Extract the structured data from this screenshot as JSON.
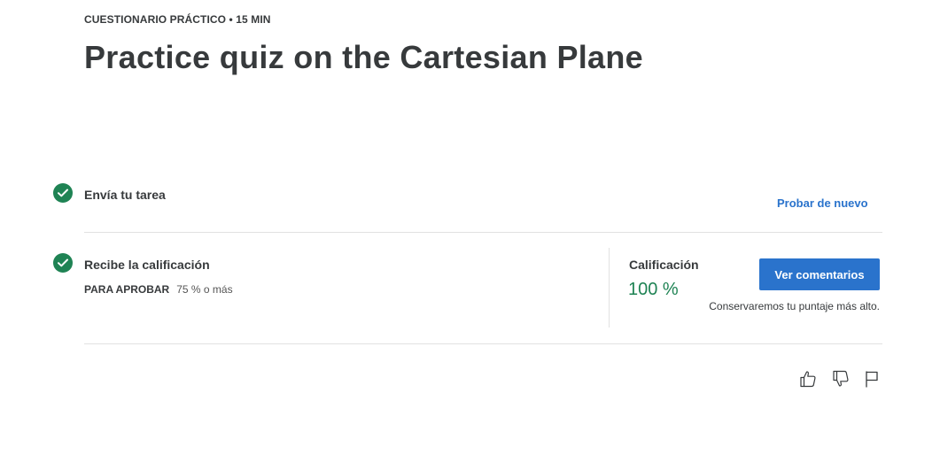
{
  "header": {
    "eyebrow": "CUESTIONARIO PRÁCTICO • 15 MIN",
    "title": "Practice quiz on the Cartesian Plane"
  },
  "steps": [
    {
      "label": "Envía tu tarea",
      "status": "complete",
      "action_label": "Probar de nuevo"
    },
    {
      "label": "Recibe la calificación",
      "status": "complete",
      "pass_key": "PARA APROBAR",
      "pass_value": "75 % o más"
    }
  ],
  "grade": {
    "label": "Calificación",
    "value": "100 %",
    "button_label": "Ver comentarios",
    "note": "Conservaremos tu puntaje más alto."
  },
  "feedback_icons": [
    "thumbs-up-icon",
    "thumbs-down-icon",
    "flag-icon"
  ],
  "colors": {
    "accent_blue": "#2a73cc",
    "success_green": "#1f8354",
    "text_dark": "#373a3c",
    "divider": "#e1e1e1"
  }
}
